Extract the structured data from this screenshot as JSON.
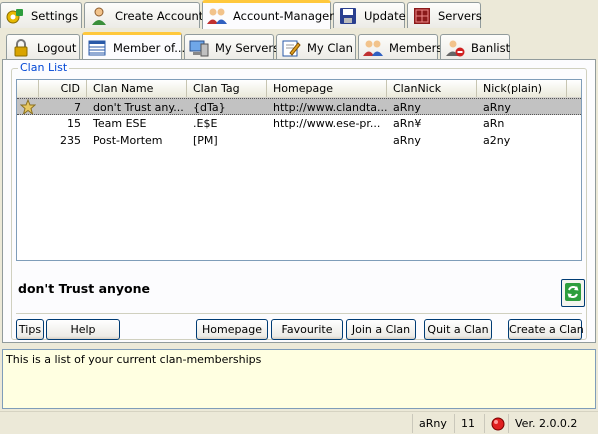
{
  "main_tabs": [
    {
      "label": "Settings"
    },
    {
      "label": "Create Account"
    },
    {
      "label": "Account-Manager"
    },
    {
      "label": "Update"
    },
    {
      "label": "Servers"
    }
  ],
  "sub_tabs": [
    {
      "label": "Logout"
    },
    {
      "label": "Member of..."
    },
    {
      "label": "My Servers"
    },
    {
      "label": "My Clan"
    },
    {
      "label": "Members"
    },
    {
      "label": "Banlist"
    }
  ],
  "clan_list": {
    "group_title": "Clan List",
    "columns": [
      "CID",
      "Clan Name",
      "Clan Tag",
      "Homepage",
      "ClanNick",
      "Nick(plain)"
    ],
    "rows": [
      {
        "cid": "7",
        "name": "don't Trust any...",
        "tag": "{dTa}",
        "homepage": "http://www.clandta...",
        "clannick": "aRny",
        "nick": "aRny"
      },
      {
        "cid": "15",
        "name": "Team ESE",
        "tag": ".E$E",
        "homepage": "http://www.ese-pr...",
        "clannick": "aRn¥",
        "nick": "aRn"
      },
      {
        "cid": "235",
        "name": "Post-Mortem",
        "tag": "[PM]",
        "homepage": "",
        "clannick": "aRny",
        "nick": "a2ny"
      }
    ]
  },
  "selected_clan": "don't Trust anyone",
  "buttons": {
    "tips": "Tips",
    "help": "Help",
    "homepage": "Homepage",
    "favourite": "Favourite",
    "join": "Join a Clan",
    "quit": "Quit a Clan",
    "create": "Create a Clan"
  },
  "info_text": "This is a list of your current clan-memberships",
  "status": {
    "user": "aRny",
    "count": "11",
    "version": "Ver. 2.0.0.2"
  },
  "colors": {
    "accent": "#ffc83c",
    "group_title": "#0046d5",
    "selection": "#c2c2c2",
    "info_bg": "#ffffe1",
    "status_light": "#e02020"
  }
}
